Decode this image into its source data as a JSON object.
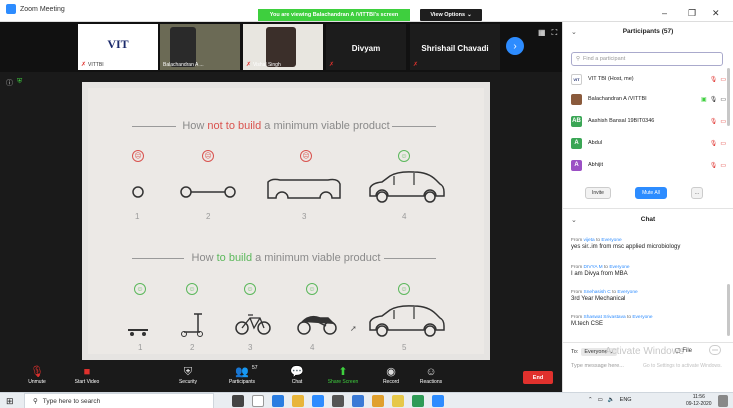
{
  "window": {
    "app_title": "Zoom Meeting"
  },
  "banner": {
    "viewing": "You are viewing Balachandran A /VITTBI's screen",
    "view_options": "View Options"
  },
  "gallery": {
    "tiles": [
      {
        "name": "VITTBI"
      },
      {
        "name": "Balachandran A ..."
      },
      {
        "name": "Vishal Singh"
      },
      {
        "name": "Divyam"
      },
      {
        "name": "Shrishail Chavadi"
      }
    ],
    "logo_text": "VIT"
  },
  "slide": {
    "heading1_pre": "How ",
    "heading1_emph": "not to build",
    "heading1_post": " a minimum viable product",
    "heading2_pre": "How ",
    "heading2_emph": "to build",
    "heading2_post": " a minimum viable product",
    "row1_numbers": [
      "1",
      "2",
      "3",
      "4"
    ],
    "row2_numbers": [
      "1",
      "2",
      "3",
      "4",
      "5"
    ]
  },
  "toolbar": {
    "unmute": "Unmute",
    "start_video": "Start Video",
    "security": "Security",
    "participants": "Participants",
    "participants_count": "57",
    "chat": "Chat",
    "share_screen": "Share Screen",
    "record": "Record",
    "reactions": "Reactions",
    "end": "End"
  },
  "participants_panel": {
    "title": "Participants (57)",
    "search_placeholder": "Find a participant",
    "people": [
      {
        "name": "VIT TBI (Host, me)",
        "avatar": "VIT",
        "color": "#ffffff"
      },
      {
        "name": "Balachandran A /VITTBI",
        "avatar": "",
        "color": "#8a5a3c"
      },
      {
        "name": "Aashish Bansal 19BIT0346",
        "avatar": "AB",
        "color": "#3aa655"
      },
      {
        "name": "Abdul",
        "avatar": "A",
        "color": "#3aa655"
      },
      {
        "name": "Abhijit",
        "avatar": "A",
        "color": "#9b4fc4"
      }
    ],
    "invite": "Invite",
    "mute_all": "Mute All",
    "more": "..."
  },
  "chat_panel": {
    "title": "Chat",
    "messages": [
      {
        "from": "vijeta",
        "to": "Everyone",
        "text": "yes sir..im from msc applied microbiology"
      },
      {
        "from": "DIVYA M",
        "to": "Everyone",
        "text": "I am Divya from MBA"
      },
      {
        "from": "Snehasish C",
        "to": "Everyone",
        "text": "3rd Year Mechanical"
      },
      {
        "from": "Shaswat Srivastava",
        "to": "Everyone",
        "text": "M.tech CSE"
      }
    ],
    "from_word": "From ",
    "to_word": " to ",
    "to_label": "To:",
    "to_value": "Everyone",
    "file": "File",
    "placeholder": "Type message here...",
    "watermark": "Activate Windows",
    "watermark_sub": "Go to Settings to activate Windows."
  },
  "taskbar": {
    "search": "Type here to search",
    "tray": "ENG",
    "time": "11:56",
    "date": "09-12-2020"
  }
}
